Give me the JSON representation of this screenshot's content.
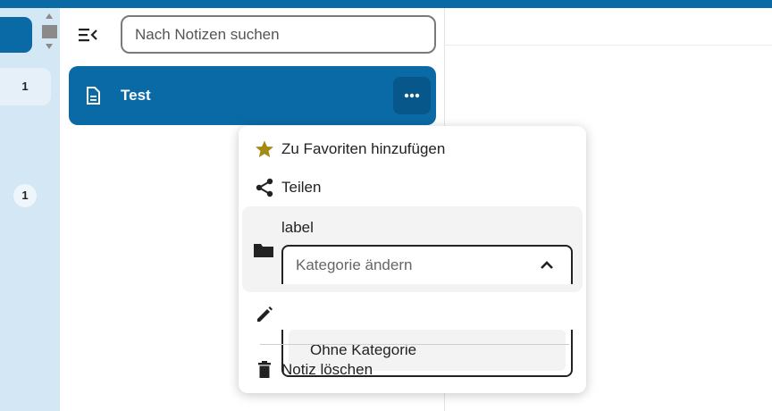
{
  "colors": {
    "primary": "#0a6aa6",
    "nav_background": "#d4e7f4",
    "favorite_star": "#a38a12"
  },
  "nav": {
    "counts": [
      "1",
      "1"
    ]
  },
  "search": {
    "placeholder": "Nach Notizen suchen"
  },
  "note_list": {
    "items": [
      {
        "title": "Test",
        "icon": "document-icon"
      }
    ]
  },
  "menu": {
    "favorite_label": "Zu Favoriten hinzufügen",
    "share_label": "Teilen",
    "category": {
      "label": "label",
      "select_placeholder": "Kategorie ändern",
      "options": [
        "Ohne Kategorie"
      ]
    },
    "delete_label": "Notiz löschen"
  }
}
